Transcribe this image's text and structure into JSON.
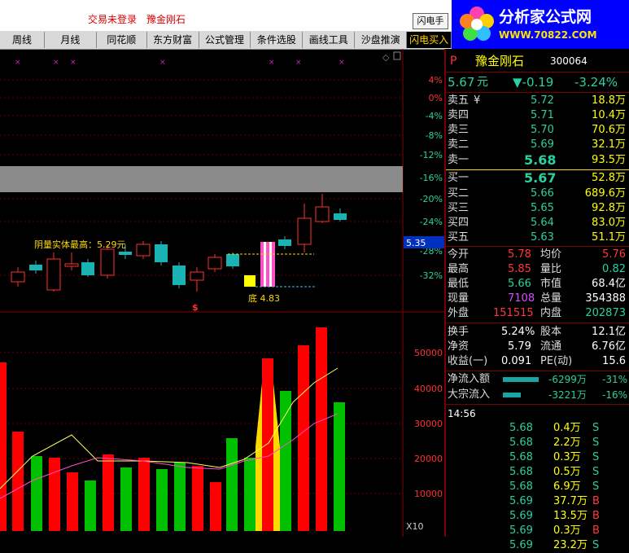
{
  "topbar": {
    "status": "交易未登录",
    "stock_name": "豫金刚石",
    "flash_button": "闪电手"
  },
  "logo": {
    "name": "分析家公式网",
    "url": "WWW.70822.COM"
  },
  "menu": [
    {
      "label": "周线"
    },
    {
      "label": "月线"
    },
    {
      "label": "同花顺"
    },
    {
      "label": "东方财富"
    },
    {
      "label": "公式管理"
    },
    {
      "label": "条件选股"
    },
    {
      "label": "画线工具"
    },
    {
      "label": "沙盘推演"
    },
    {
      "label": "闪电买入"
    }
  ],
  "chart": {
    "price_axis": [
      "4%",
      "0%",
      "-4%",
      "-8%",
      "-12%",
      "-16%",
      "-20%",
      "-24%",
      "-28%",
      "-32%"
    ],
    "current_price_tag": "5.35",
    "annotation": "阴量实体最高：5.29元",
    "bottom_label": "底 4.83",
    "marker": "$",
    "volume_axis": [
      "50000",
      "40000",
      "30000",
      "20000",
      "10000"
    ],
    "multiplier": "X10",
    "colors": {
      "up": "#ff2020",
      "down": "#1ab2b2",
      "volume_up": "#ff0000",
      "volume_down": "#00c000",
      "yellow": "#ffd800",
      "magenta": "#ff50c8"
    }
  },
  "quote": {
    "market_tag": "P",
    "name": "豫金刚石",
    "code": "300064",
    "price": "5.67",
    "price_unit": "元",
    "change": "▼-0.19",
    "change_pct": "-3.24%",
    "sell_yen_symbol": "¥",
    "sells": [
      {
        "label": "卖五",
        "price": "5.72",
        "vol": "18.8万"
      },
      {
        "label": "卖四",
        "price": "5.71",
        "vol": "10.4万"
      },
      {
        "label": "卖三",
        "price": "5.70",
        "vol": "70.6万"
      },
      {
        "label": "卖二",
        "price": "5.69",
        "vol": "32.1万"
      },
      {
        "label": "卖一",
        "price": "5.68",
        "vol": "93.5万"
      }
    ],
    "buys": [
      {
        "label": "买一",
        "price": "5.67",
        "vol": "52.8万"
      },
      {
        "label": "买二",
        "price": "5.66",
        "vol": "689.6万"
      },
      {
        "label": "买三",
        "price": "5.65",
        "vol": "92.8万"
      },
      {
        "label": "买四",
        "price": "5.64",
        "vol": "83.0万"
      },
      {
        "label": "买五",
        "price": "5.63",
        "vol": "51.1万"
      }
    ],
    "stats": [
      {
        "l1": "今开",
        "v1": "5.78",
        "l2": "均价",
        "v2": "5.76"
      },
      {
        "l1": "最高",
        "v1": "5.85",
        "l2": "量比",
        "v2": "0.82"
      },
      {
        "l1": "最低",
        "v1": "5.66",
        "l2": "市值",
        "v2": "68.4亿"
      },
      {
        "l1": "现量",
        "v1": "7108",
        "l2": "总量",
        "v2": "354388"
      },
      {
        "l1": "外盘",
        "v1": "151515",
        "l2": "内盘",
        "v2": "202873"
      }
    ],
    "fund": [
      {
        "l1": "换手",
        "v1": "5.24%",
        "l2": "股本",
        "v2": "12.1亿"
      },
      {
        "l1": "净资",
        "v1": "5.79",
        "l2": "流通",
        "v2": "6.76亿"
      },
      {
        "l1": "收益(一)",
        "v1": "0.091",
        "l2": "PE(动)",
        "v2": "15.6"
      }
    ],
    "flows": [
      {
        "label": "净流入额",
        "value": "-6299万",
        "pct": "-31%",
        "bar_fraction": 0.8
      },
      {
        "label": "大宗流入",
        "value": "-3221万",
        "pct": "-16%",
        "bar_fraction": 0.4
      }
    ],
    "ticks_time": "14:56",
    "ticks": [
      {
        "price": "5.68",
        "vol": "0.4万",
        "side": "S"
      },
      {
        "price": "5.68",
        "vol": "2.2万",
        "side": "S"
      },
      {
        "price": "5.68",
        "vol": "0.3万",
        "side": "S"
      },
      {
        "price": "5.68",
        "vol": "0.5万",
        "side": "S"
      },
      {
        "price": "5.68",
        "vol": "6.9万",
        "side": "S"
      },
      {
        "price": "5.69",
        "vol": "37.7万",
        "side": "B"
      },
      {
        "price": "5.69",
        "vol": "13.5万",
        "side": "B"
      },
      {
        "price": "5.69",
        "vol": "0.3万",
        "side": "B"
      },
      {
        "price": "5.69",
        "vol": "23.2万",
        "side": "S"
      }
    ]
  }
}
